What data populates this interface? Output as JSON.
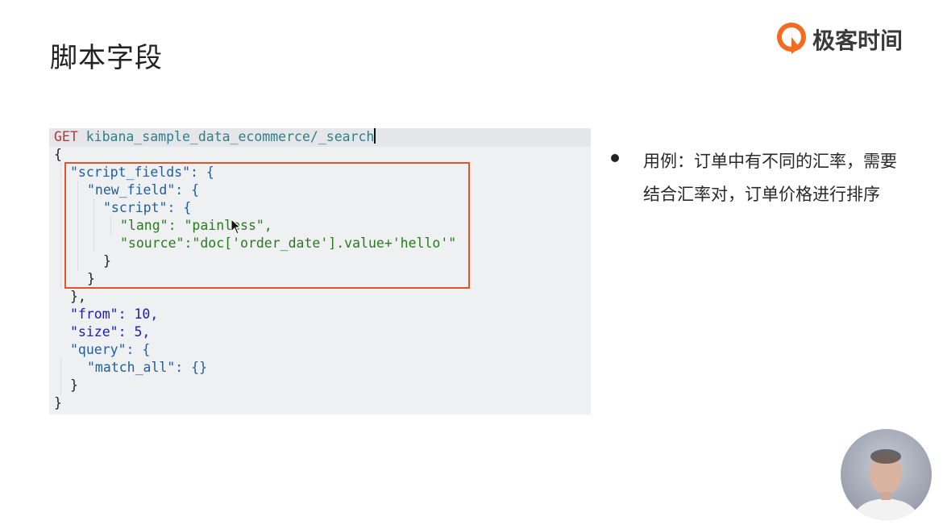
{
  "slide": {
    "title": "脚本字段",
    "logo_text": "极客时间",
    "bullet_text": "用例：订单中有不同的汇率，需要结合汇率对，订单价格进行排序"
  },
  "code": {
    "method": "GET",
    "url": "kibana_sample_data_ecommerce/_search",
    "lines": [
      "{",
      "\"script_fields\": {",
      "\"new_field\": {",
      "\"script\": {",
      "\"lang\": \"painless\",",
      "\"source\":\"doc['order_date'].value+'hello'\"",
      "}",
      "}",
      "},",
      "\"from\": 10,",
      "\"size\": 5,",
      "\"query\": {",
      "\"match_all\": {}",
      "}",
      "}"
    ]
  },
  "colors": {
    "highlight_border": "#e0562a",
    "logo_orange": "#f26b21"
  },
  "icons": {
    "logo": "geektime-logo-icon",
    "cursor": "mouse-pointer-icon",
    "bullet": "bullet-dot-icon",
    "presenter": "presenter-avatar"
  }
}
